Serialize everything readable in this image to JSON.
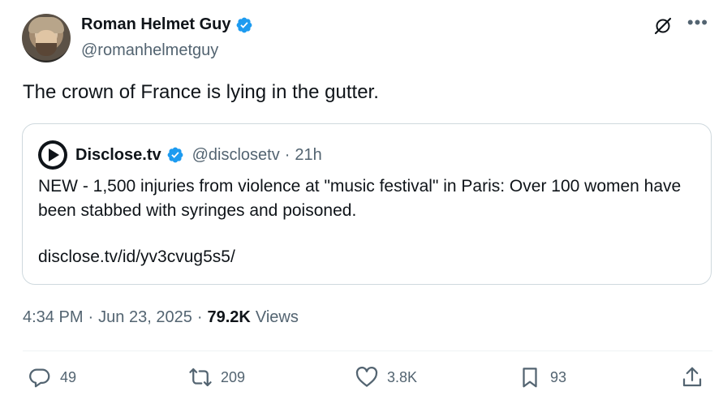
{
  "author": {
    "display_name": "Roman Helmet Guy",
    "handle": "@romanhelmetguy",
    "verified": true
  },
  "tweet": {
    "text": "The crown of France is lying in the gutter."
  },
  "quote": {
    "display_name": "Disclose.tv",
    "handle": "@disclosetv",
    "separator": "·",
    "time": "21h",
    "body": "NEW - 1,500 injuries from violence at \"music festival\" in Paris: Over 100 women have been stabbed with syringes and poisoned.",
    "link": "disclose.tv/id/yv3cvug5s5/"
  },
  "meta": {
    "time": "4:34 PM",
    "dot1": "·",
    "date": "Jun 23, 2025",
    "dot2": "·",
    "views_count": "79.2K",
    "views_label": "Views"
  },
  "actions": {
    "replies": "49",
    "reposts": "209",
    "likes": "3.8K",
    "bookmarks": "93"
  },
  "colors": {
    "verified_blue": "#1d9bf0",
    "muted_text": "#536471",
    "border": "#cfd9de"
  }
}
